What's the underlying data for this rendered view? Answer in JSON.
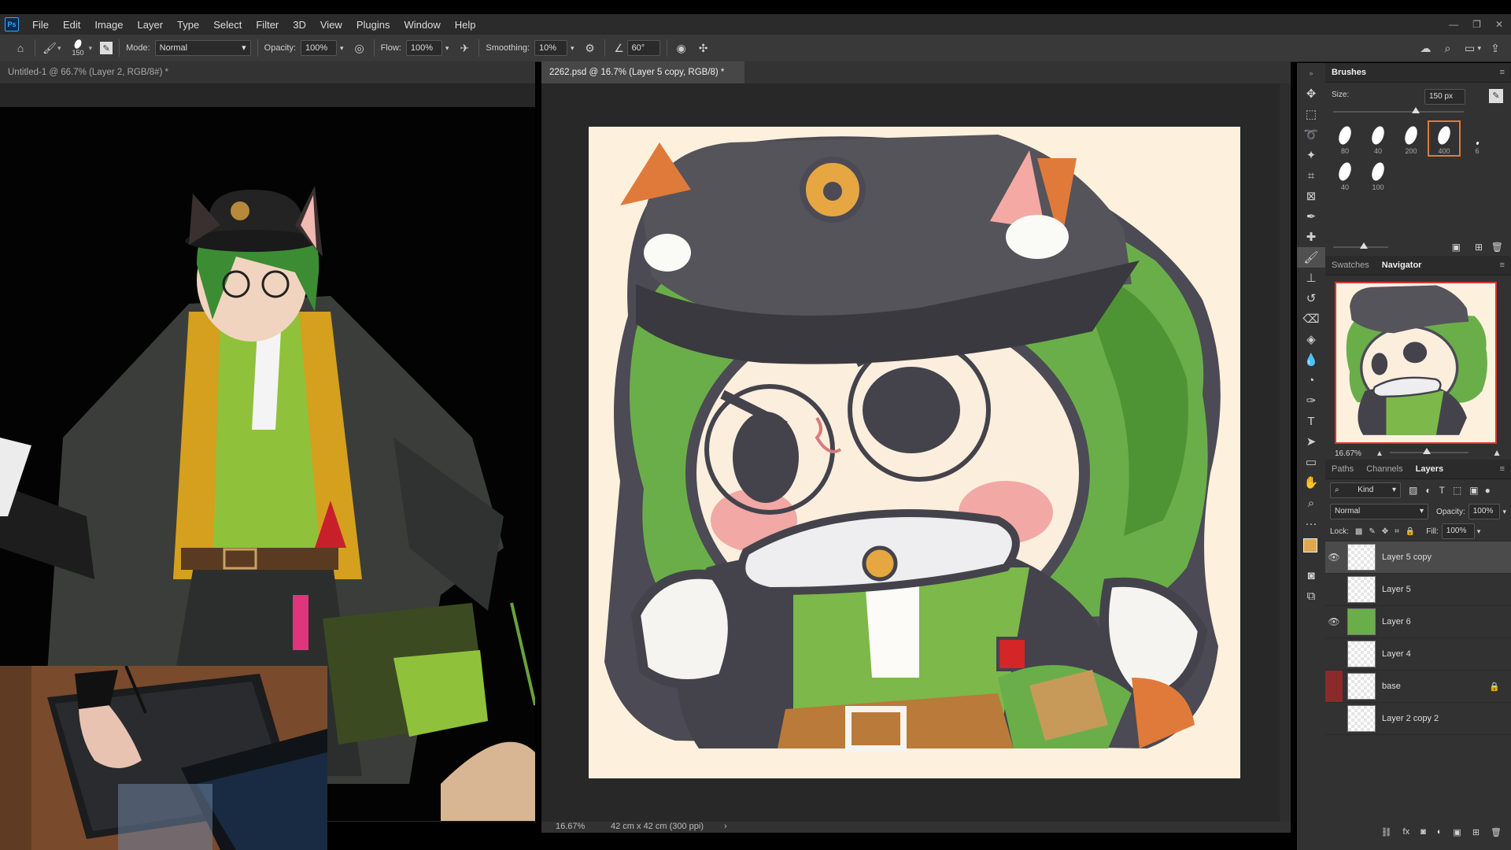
{
  "menu": {
    "app_icon": "Ps",
    "items": [
      "File",
      "Edit",
      "Image",
      "Layer",
      "Type",
      "Select",
      "Filter",
      "3D",
      "View",
      "Plugins",
      "Window",
      "Help"
    ]
  },
  "window_controls": [
    "minimize-icon",
    "restore-icon",
    "close-icon"
  ],
  "options_bar": {
    "brush_size": "150",
    "mode_label": "Mode:",
    "mode_value": "Normal",
    "opacity_label": "Opacity:",
    "opacity_value": "100%",
    "flow_label": "Flow:",
    "flow_value": "100%",
    "smoothing_label": "Smoothing:",
    "smoothing_value": "10%",
    "angle_value": "60°"
  },
  "tabs": {
    "doc1": "Untitled-1 @ 66.7% (Layer 2, RGB/8#) *",
    "doc2": "2262.psd @ 16.7% (Layer 5 copy, RGB/8) *",
    "close": "×"
  },
  "status": {
    "zoom": "16.67%",
    "doc_info": "42 cm x 42 cm (300 ppi)",
    "arrow": "›"
  },
  "brushes_panel": {
    "title": "Brushes",
    "size_label": "Size:",
    "size_value": "150 px",
    "tips": [
      "80",
      "40",
      "200",
      "400",
      "6",
      "40",
      "100"
    ]
  },
  "navigator_panel": {
    "tabs": [
      "Swatches",
      "Navigator"
    ],
    "zoom": "16.67%"
  },
  "layers_panel": {
    "tabs": [
      "Paths",
      "Channels",
      "Layers"
    ],
    "filter_kind": "Kind",
    "blend_mode": "Normal",
    "opacity_label": "Opacity:",
    "opacity_value": "100%",
    "lock_label": "Lock:",
    "fill_label": "Fill:",
    "fill_value": "100%",
    "layers": [
      {
        "name": "Layer 5 copy",
        "visible": true,
        "selected": true
      },
      {
        "name": "Layer 5",
        "visible": false,
        "selected": false
      },
      {
        "name": "Layer 6",
        "visible": true,
        "selected": false
      },
      {
        "name": "Layer 4",
        "visible": false,
        "selected": false
      },
      {
        "name": "base",
        "visible": false,
        "selected": false,
        "locked": true
      },
      {
        "name": "Layer 2 copy 2",
        "visible": false,
        "selected": false
      }
    ]
  },
  "colors": {
    "foreground": "#e0a84e",
    "background": "#000000",
    "accent": "#31a8ff"
  }
}
